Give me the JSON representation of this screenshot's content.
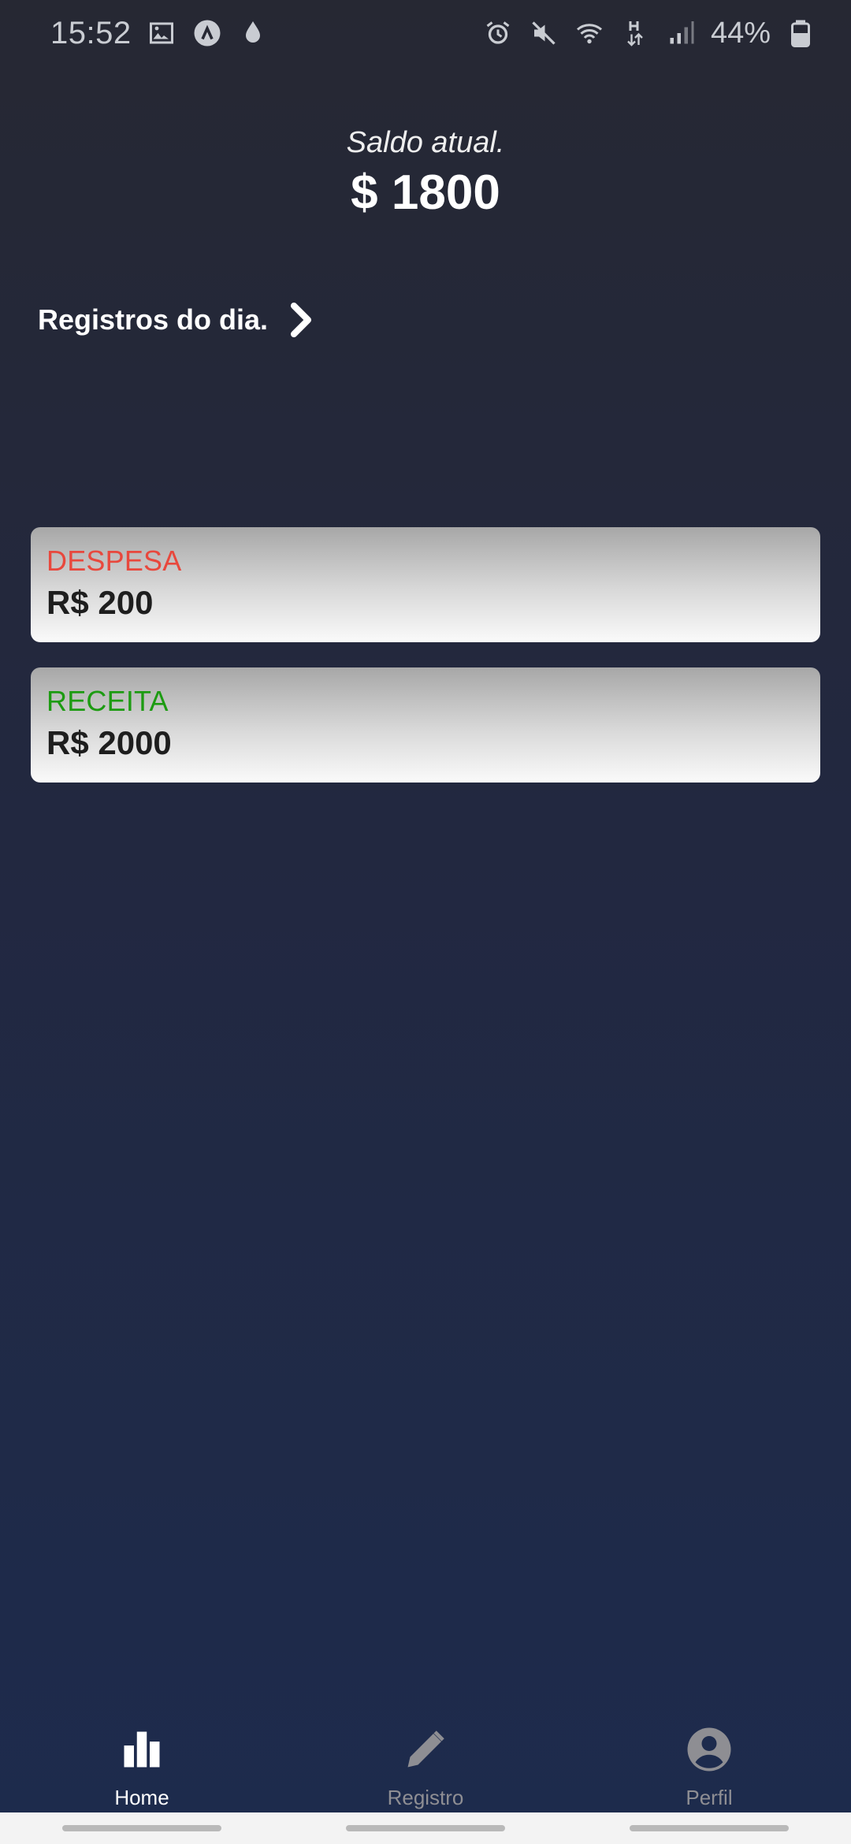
{
  "status_bar": {
    "time": "15:52",
    "battery_text": "44%",
    "icons_left": [
      "image-icon",
      "app-icon",
      "drop-icon"
    ],
    "icons_right": [
      "alarm-icon",
      "mute-icon",
      "wifi-icon",
      "data-h-icon",
      "signal-icon",
      "battery-icon"
    ]
  },
  "balance": {
    "label": "Saldo atual.",
    "value": "$ 1800"
  },
  "daily": {
    "label": "Registros do dia.",
    "icon": "chevron-right-icon"
  },
  "records": [
    {
      "type": "DESPESA",
      "amount": "R$ 200",
      "color": "#e8483d"
    },
    {
      "type": "RECEITA",
      "amount": "R$ 2000",
      "color": "#1d9b12"
    }
  ],
  "tabs": [
    {
      "label": "Home",
      "icon": "bar-chart-icon",
      "active": true
    },
    {
      "label": "Registro",
      "icon": "pencil-icon",
      "active": false
    },
    {
      "label": "Perfil",
      "icon": "user-circle-icon",
      "active": false
    }
  ],
  "colors": {
    "background_top": "#262833",
    "background_bottom": "#1d2b4d",
    "active_tab": "#ffffff",
    "inactive_tab": "#8e8e93"
  }
}
